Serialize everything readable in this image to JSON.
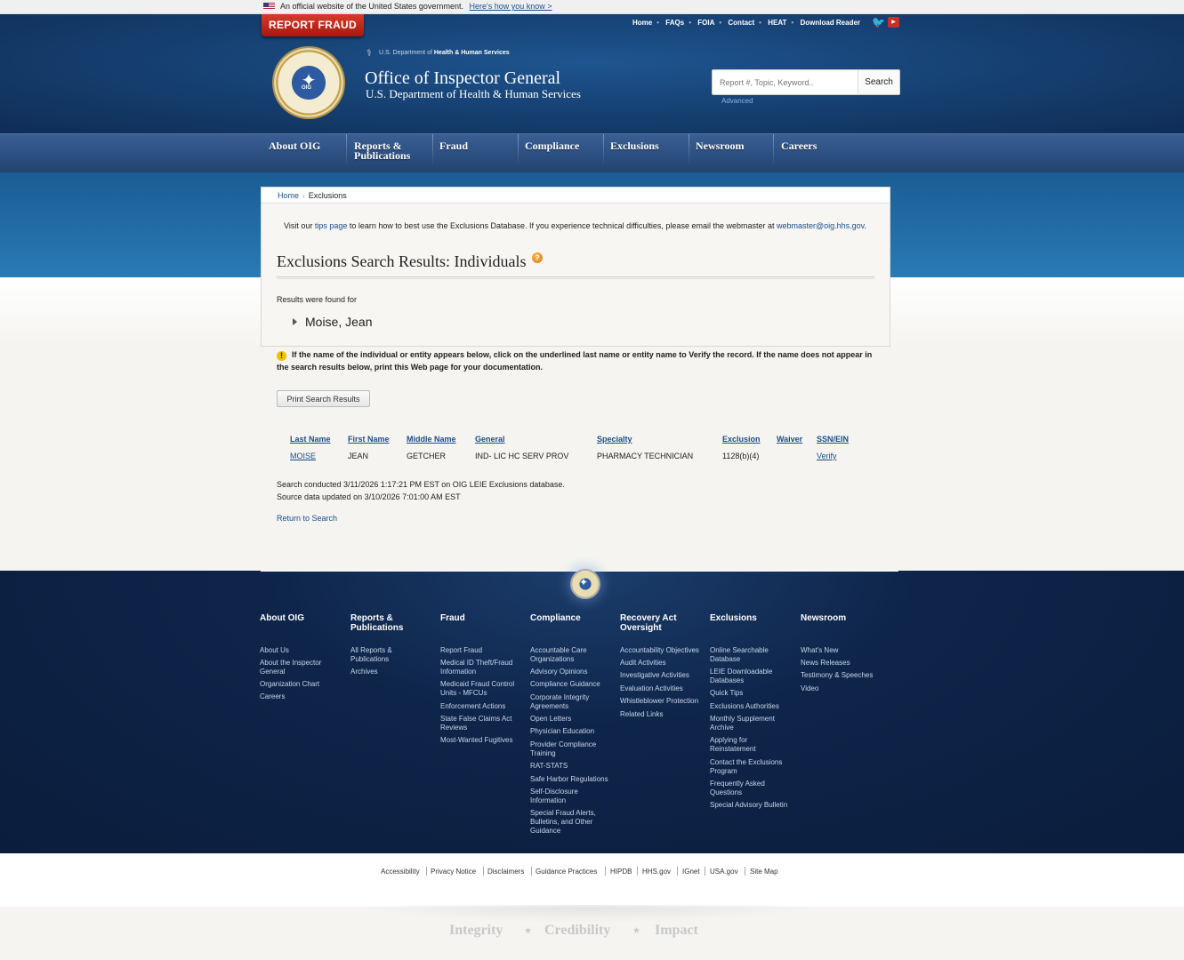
{
  "gov_banner": {
    "text": "An official website of the United States government.",
    "link": "Here's how you know >"
  },
  "header": {
    "report_fraud": "REPORT FRAUD",
    "utility_links": [
      "Home",
      "FAQs",
      "FOIA",
      "Contact",
      "HEAT",
      "Download Reader"
    ],
    "dept_small_prefix": "U.S. Department of",
    "dept_small_bold": "Health & Human Services",
    "seal_text": "OIG",
    "title": "Office of Inspector General",
    "subtitle": "U.S. Department of Health & Human Services",
    "search_placeholder": "Report #, Topic, Keyword..",
    "search_button": "Search",
    "advanced": "Advanced"
  },
  "nav": [
    "About OIG",
    "Reports &\nPublications",
    "Fraud",
    "Compliance",
    "Exclusions",
    "Newsroom",
    "Careers"
  ],
  "breadcrumb": {
    "home": "Home",
    "current": "Exclusions"
  },
  "tips": {
    "pre": "Visit our ",
    "link": "tips page",
    "mid": " to learn how to best use the Exclusions Database. If you experience technical difficulties, please email the webmaster at ",
    "email": "webmaster@oig.hhs.gov",
    "post": "."
  },
  "page_title": "Exclusions Search Results: Individuals",
  "results_label": "Results were found for",
  "search_name": "Moise, Jean",
  "notice": "If the name of the individual or entity appears below, click on the underlined last name or entity name to Verify the record. If the name does not appear in the search results below, print this Web page for your documentation.",
  "print_button": "Print Search Results",
  "table": {
    "headers": [
      "Last Name",
      "First Name",
      "Middle Name",
      "General",
      "Specialty",
      "Exclusion",
      "Waiver",
      "SSN/EIN"
    ],
    "rows": [
      [
        "MOISE",
        "JEAN",
        "GETCHER",
        "IND- LIC HC SERV PROV",
        "PHARMACY TECHNICIAN",
        "1128(b)(4)",
        "",
        "Verify"
      ]
    ]
  },
  "meta": {
    "conducted": "Search conducted 3/11/2026 1:17:21 PM EST on OIG LEIE Exclusions database.",
    "updated": "Source data updated on 3/10/2026 7:01:00 AM EST"
  },
  "return_link": "Return to Search",
  "footer": {
    "columns": [
      {
        "head": "About OIG",
        "links": [
          "About Us",
          "About the Inspector\nGeneral",
          "Organization Chart",
          "Careers"
        ]
      },
      {
        "head": "Reports &\nPublications",
        "links": [
          "All Reports &\nPublications",
          "Archives"
        ]
      },
      {
        "head": "Fraud",
        "links": [
          "Report Fraud",
          "Medical ID Theft/Fraud\nInformation",
          "Medicaid Fraud Control\nUnits - MFCUs",
          "Enforcement Actions",
          "State False Claims Act\nReviews",
          "Most-Wanted Fugitives"
        ]
      },
      {
        "head": "Compliance",
        "links": [
          "Accountable Care\nOrganizations",
          "Advisory Opinions",
          "Compliance Guidance",
          "Corporate Integrity\nAgreements",
          "Open Letters",
          "Physician Education",
          "Provider Compliance\nTraining",
          "RAT-STATS",
          "Safe Harbor Regulations",
          "Self-Disclosure\nInformation",
          "Special Fraud Alerts,\nBulletins, and Other\nGuidance"
        ]
      },
      {
        "head": "Recovery Act\nOversight",
        "links": [
          "Accountability Objectives",
          "Audit Activities",
          "Investigative Activities",
          "Evaluation Activities",
          "Whistleblower Protection",
          "Related Links"
        ]
      },
      {
        "head": "Exclusions",
        "links": [
          "Online Searchable\nDatabase",
          "LEIE Downloadable\nDatabases",
          "Quick Tips",
          "Exclusions Authorities",
          "Monthly Supplement\nArchive",
          "Applying for\nReinstatement",
          "Contact the Exclusions\nProgram",
          "Frequently Asked\nQuestions",
          "Special Advisory Bulletin"
        ]
      },
      {
        "head": "Newsroom",
        "links": [
          "What's New",
          "News Releases",
          "Testimony & Speeches",
          "Video"
        ]
      }
    ],
    "bottom_links": [
      "Accessibility",
      "Privacy Notice",
      "Disclaimers",
      "Guidance Practices",
      "HIPDB",
      "HHS.gov",
      "IGnet",
      "USA.gov",
      "Site Map"
    ],
    "motto": [
      "Integrity",
      "Credibility",
      "Impact"
    ]
  }
}
